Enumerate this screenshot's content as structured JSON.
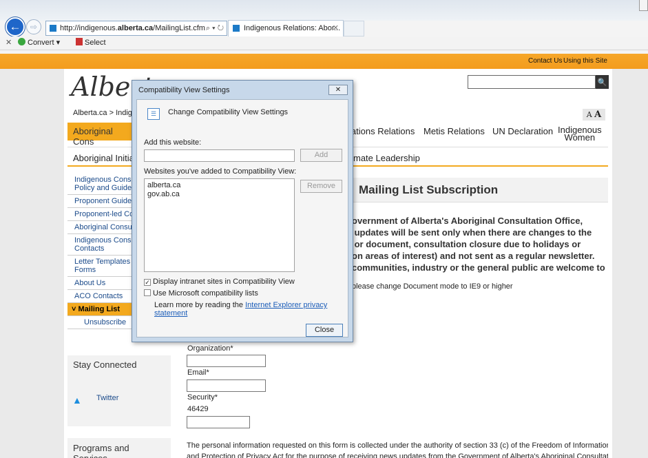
{
  "browser": {
    "address": {
      "prefix": "http://indigenous.",
      "host": "alberta.ca",
      "path": "/MailingList.cfm",
      "controls": "⌕ ▾ ↻"
    },
    "tab": {
      "title": "Indigenous Relations: Abor...",
      "close": "✕"
    },
    "back_icon": "←",
    "forward_icon": "⇨",
    "commandbar": {
      "close": "✕",
      "convert": "Convert ▾",
      "select": "Select"
    }
  },
  "page": {
    "toplinks": [
      "Contact Us",
      "Using this Site"
    ],
    "logo": "Albert",
    "breadcrumb": "Alberta.ca > Indige",
    "font_size": {
      "small": "A",
      "large": "A"
    },
    "search_icon": "🔍",
    "nav1": {
      "current": "Aboriginal Cons",
      "items": [
        "lations Relations",
        "Metis Relations",
        "UN Declaration",
        "Indigenous\nWomen"
      ]
    },
    "nav2": {
      "items": [
        "Aboriginal Initiat",
        "mate Leadership"
      ]
    },
    "sidebar": [
      "Indigenous Cons\nPolicy and Guide",
      "Proponent Guide",
      "Proponent-led Co",
      "Aboriginal Consu",
      "Indigenous Cons\nContacts",
      "Letter Templates\nForms",
      "About Us",
      "ACO Contacts",
      "Mailing List",
      "Unsubscribe"
    ],
    "sidebar_current_prefix": "˅",
    "stay_connected": "Stay Connected",
    "twitter": "Twitter",
    "programs": "Programs and Services",
    "title": "Mailing List Subscription",
    "intro": "overnment of Alberta's Aboriginal Consultation Office,\n updates will be sent only when there are changes to the\n or document, consultation closure due to holidays or\non areas of interest) and not sent as a regular newsletter.\ncommunities, industry or the general public are welcome to",
    "doc_mode_warning": "please change Document mode to IE9 or higher",
    "form": {
      "organization": "Organization*",
      "email": "Email*",
      "security": "Security*",
      "code": "46429"
    },
    "privacy": "The personal information requested on this form is collected under the authority of section 33 (c) of the Freedom of Information\nand Protection of Privacy Act for the purpose of receiving news updates from the Government of Alberta's Aboriginal Consultation"
  },
  "dialog": {
    "title": "Compatibility View Settings",
    "close_icon": "✕",
    "heading": "Change Compatibility View Settings",
    "add_label": "Add this website:",
    "add_value": "",
    "add_button": "Add",
    "list_label": "Websites you've added to Compatibility View:",
    "sites": [
      "alberta.ca",
      "gov.ab.ca"
    ],
    "remove_button": "Remove",
    "check_intranet": "Display intranet sites in Compatibility View",
    "check_intranet_checked": true,
    "check_ms": "Use Microsoft compatibility lists",
    "check_ms_checked": false,
    "learn_prefix": "Learn more by reading the ",
    "learn_link": "Internet Explorer privacy statement",
    "close_button": "Close"
  }
}
